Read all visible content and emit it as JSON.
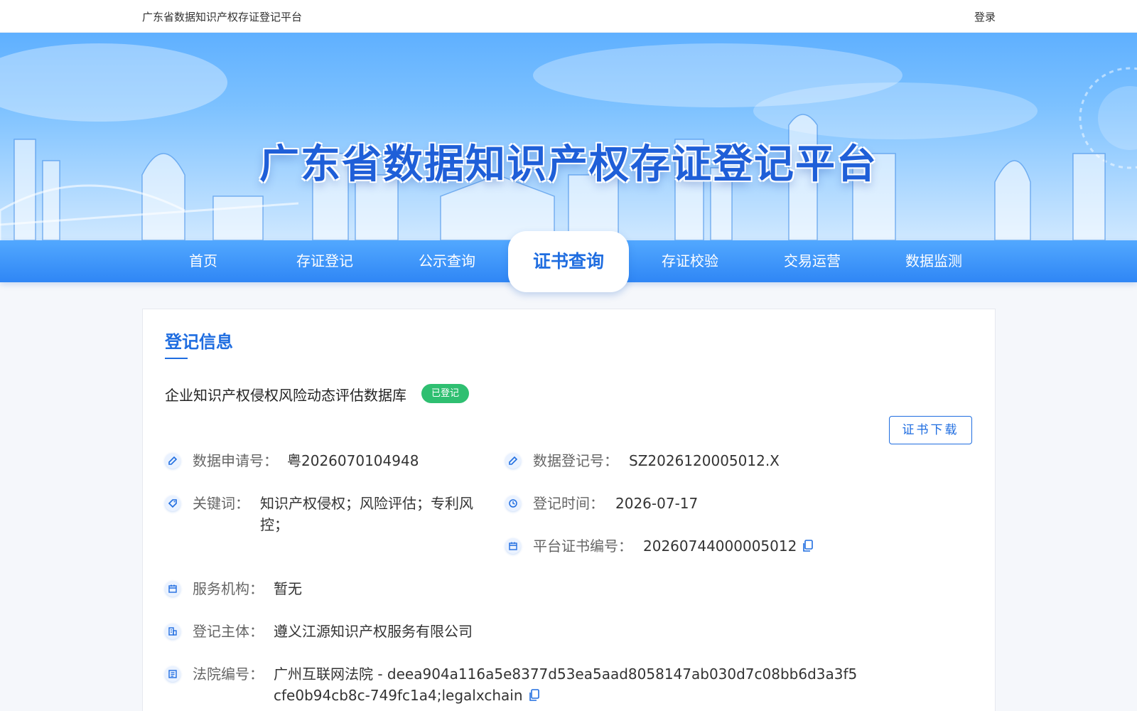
{
  "topbar": {
    "site_title": "广东省数据知识产权存证登记平台",
    "login": "登录"
  },
  "banner": {
    "title": "广东省数据知识产权存证登记平台"
  },
  "nav": {
    "items": [
      "首页",
      "存证登记",
      "公示查询",
      "证书查询",
      "存证校验",
      "交易运营",
      "数据监测"
    ],
    "active_index": 3
  },
  "section": {
    "title": "登记信息"
  },
  "record": {
    "name": "企业知识产权侵权风险动态评估数据库",
    "status": "已登记",
    "download_label": "证书下载",
    "fields": {
      "application_no": {
        "label": "数据申请号：",
        "value": "粤2026070104948"
      },
      "registration_no": {
        "label": "数据登记号：",
        "value": "SZ2026120005012.X"
      },
      "keywords": {
        "label": "关键词：",
        "value": "知识产权侵权；风险评估；专利风控；"
      },
      "reg_time": {
        "label": "登记时间：",
        "value": "2026-07-17"
      },
      "cert_no": {
        "label": "平台证书编号：",
        "value": "20260744000005012"
      },
      "service_org": {
        "label": "服务机构：",
        "value": "暂无"
      },
      "subject": {
        "label": "登记主体：",
        "value": "遵义江源知识产权服务有限公司"
      },
      "court_no": {
        "label": "法院编号：",
        "value": "广州互联网法院 - deea904a116a5e8377d53ea5aad8058147ab030d7c08bb6d3a3f5cfe0b94cb8c-749fc1a4;legalxchain"
      }
    }
  },
  "colors": {
    "primary": "#1f6de0",
    "nav": "#2f86f5",
    "badge": "#2fbf71"
  },
  "icons": {
    "edit": "edit-icon",
    "tag": "tag-icon",
    "clock": "clock-icon",
    "calendar": "calendar-icon",
    "building": "building-icon",
    "document": "document-icon",
    "copy": "copy-icon"
  }
}
